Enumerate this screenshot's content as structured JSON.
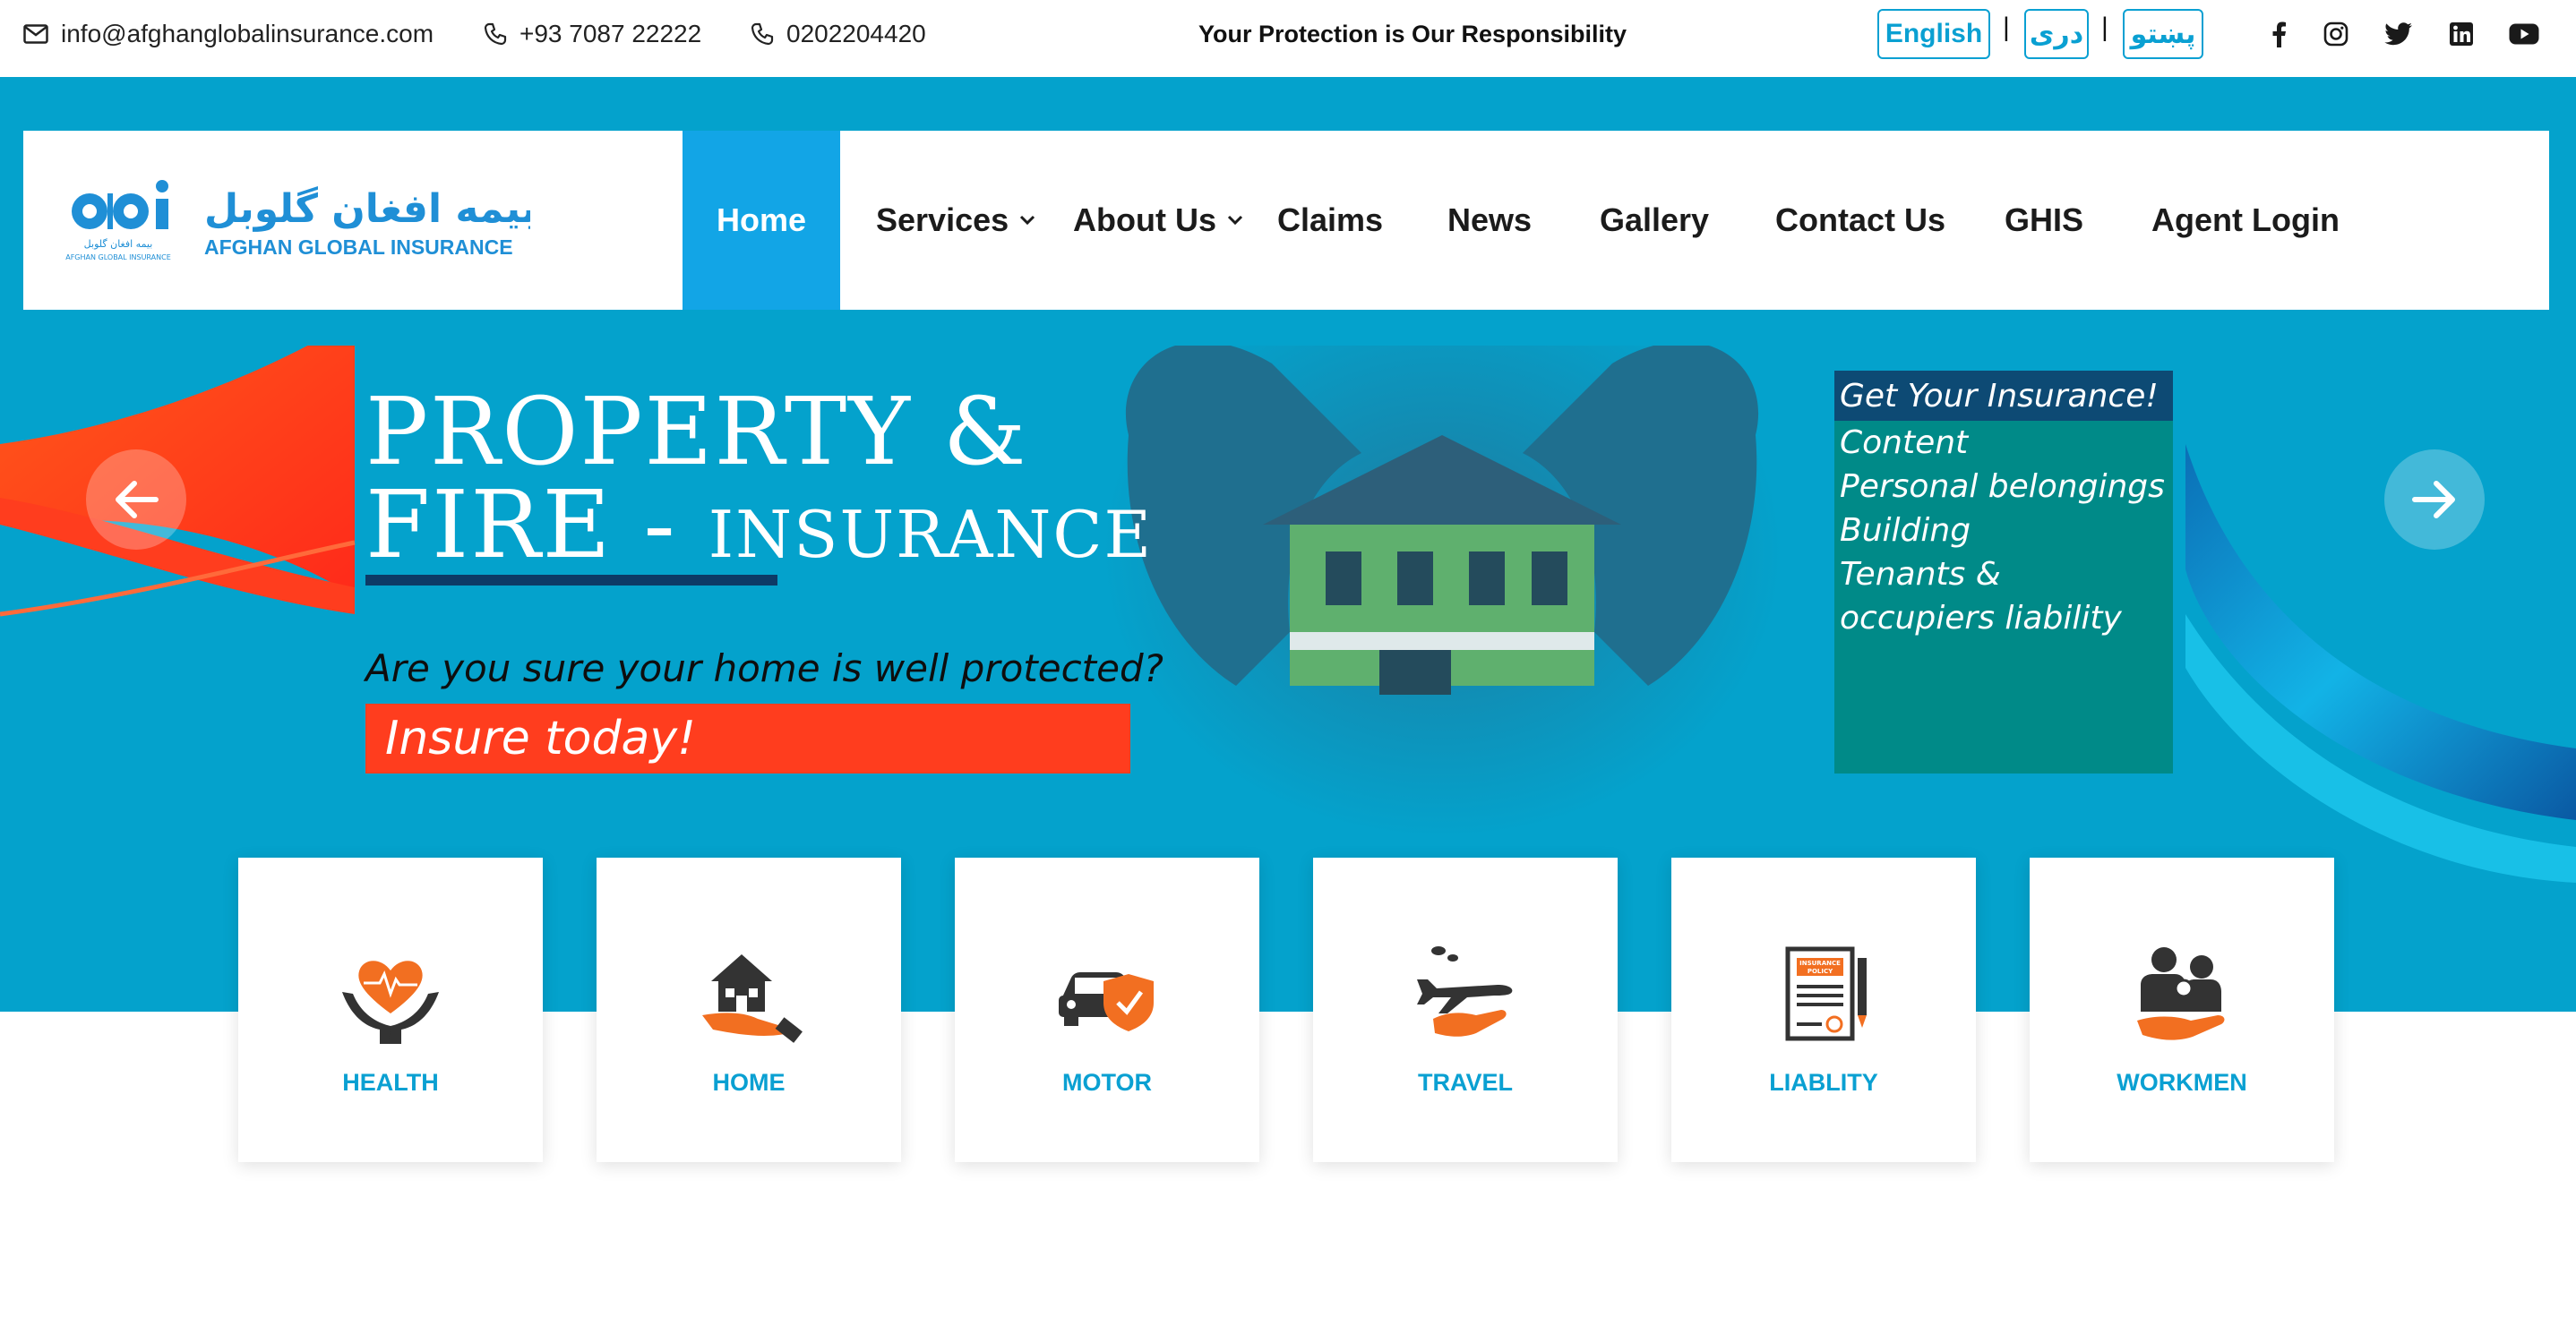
{
  "topbar": {
    "email": "info@afghanglobalinsurance.com",
    "phone1": "+93 7087 22222",
    "phone2": "0202204420",
    "tagline": "Your Protection is Our Responsibility",
    "languages": [
      "English",
      "دری",
      "پښتو"
    ],
    "separator": "|",
    "social": [
      "facebook-icon",
      "instagram-icon",
      "twitter-icon",
      "linkedin-icon",
      "youtube-icon"
    ]
  },
  "logo": {
    "mark": "agi",
    "name_fa": "بیمه افغان گلوبل",
    "name_en": "AFGHAN GLOBAL INSURANCE",
    "mark_caption_fa": "بیمه افغان گلوبل",
    "mark_caption_en": "AFGHAN GLOBAL INSURANCE"
  },
  "nav": {
    "items": [
      "Home",
      "Services",
      "About Us",
      "Claims",
      "News",
      "Gallery",
      "Contact Us",
      "GHIS",
      "Agent Login"
    ],
    "active": "Home"
  },
  "slide": {
    "headline_line1": "PROPERTY &",
    "headline_line2_main": "FIRE - ",
    "headline_line2_small": "INSURANCE",
    "question": "Are you sure your home is well protected?",
    "cta": "Insure today!",
    "panel_title": "Get Your Insurance!",
    "panel_items": [
      "Content",
      "Personal belongings",
      "Building",
      "Tenants &",
      "occupiers liability"
    ]
  },
  "categories": [
    {
      "label": "HEALTH",
      "icon": "health-icon"
    },
    {
      "label": "HOME",
      "icon": "home-icon"
    },
    {
      "label": "MOTOR",
      "icon": "motor-icon"
    },
    {
      "label": "TRAVEL",
      "icon": "travel-icon"
    },
    {
      "label": "LIABLITY",
      "icon": "liability-icon"
    },
    {
      "label": "WORKMEN",
      "icon": "workmen-icon"
    }
  ],
  "colors": {
    "brand_blue": "#04a2cc",
    "nav_active": "#12a5e6",
    "accent_orange": "#ff3d1e",
    "panel_teal": "#008a88",
    "category_text": "#0aa0d2"
  }
}
